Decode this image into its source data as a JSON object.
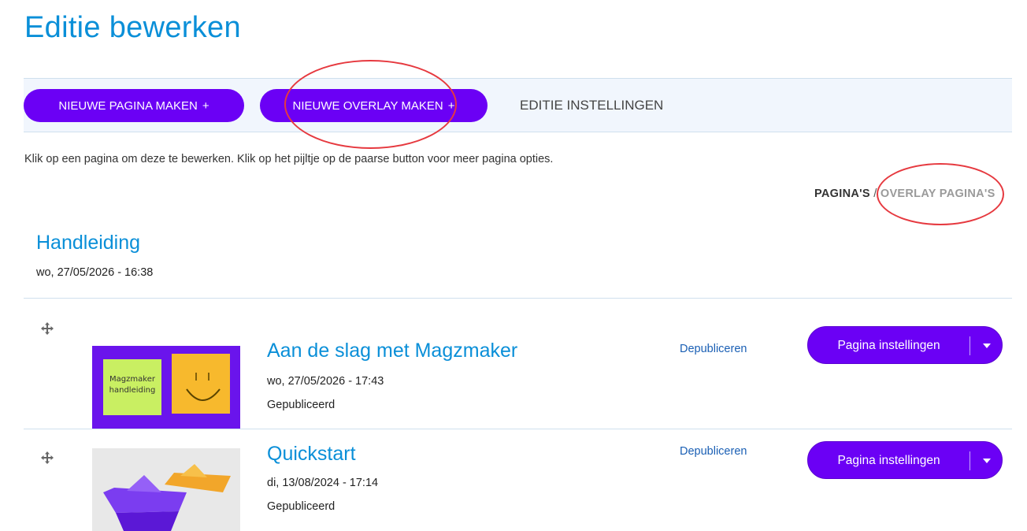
{
  "page": {
    "title": "Editie bewerken"
  },
  "toolbar": {
    "new_page_label": "NIEUWE PAGINA MAKEN",
    "new_overlay_label": "NIEUWE OVERLAY MAKEN",
    "plus": "+",
    "edition_settings_label": "EDITIE INSTELLINGEN"
  },
  "instructions": "Klik op een pagina om deze te bewerken. Klik op het pijltje op de paarse button voor meer pagina opties.",
  "switch": {
    "pages": "PAGINA'S",
    "separator": "/",
    "overlay": "OVERLAY PAGINA'S"
  },
  "section": {
    "title": "Handleiding",
    "date": "wo, 27/05/2026 - 16:38"
  },
  "rows": [
    {
      "title": "Aan de slag met Magzmaker",
      "date": "wo, 27/05/2026 - 17:43",
      "status": "Gepubliceerd",
      "unpublish": "Depubliceren",
      "settings": "Pagina instellingen",
      "thumb_note_text": "Magzmaker handleiding"
    },
    {
      "title": "Quickstart",
      "date": "di, 13/08/2024 - 17:14",
      "status": "Gepubliceerd",
      "unpublish": "Depubliceren",
      "settings": "Pagina instellingen"
    }
  ],
  "colors": {
    "accent": "#6b00f5",
    "title_blue": "#0a8fd8",
    "annotation_red": "#e6393f",
    "toolbar_bg": "#f1f6fd"
  },
  "icons": {
    "drag": "move-arrows-icon",
    "caret": "caret-down-icon"
  }
}
